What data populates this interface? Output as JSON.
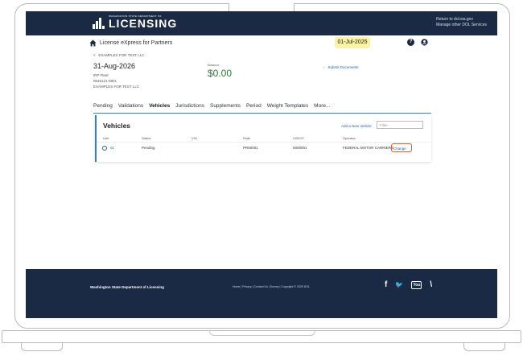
{
  "header": {
    "logo_small": "WASHINGTON STATE DEPARTMENT OF",
    "logo_big": "LICENSING",
    "return_link": "Return to dol.wa.gov",
    "manage_link": "Manage other DOL Services"
  },
  "app": {
    "title": "License eXpress for Partners",
    "date": "01-Jul-2025",
    "help_glyph": "?"
  },
  "breadcrumb": {
    "chevron": "<",
    "label": "EXAMPLES FOR TEST LLC"
  },
  "account": {
    "date": "31-Aug-2026",
    "type": "IRP Fleet",
    "id": "0546121-0801",
    "name": "EXAMPLES FOR TEST LLC",
    "balance_label": "Balance",
    "balance_value": "$0.00",
    "submit_documents": "Submit Documents"
  },
  "tabs": [
    {
      "label": "Pending"
    },
    {
      "label": "Validations"
    },
    {
      "label": "Vehicles"
    },
    {
      "label": "Jurisdictions"
    },
    {
      "label": "Supplements"
    },
    {
      "label": "Period"
    },
    {
      "label": "Weight Templates"
    },
    {
      "label": "More..."
    }
  ],
  "vehicles": {
    "title": "Vehicles",
    "add_link": "Add a New Vehicle",
    "filter_placeholder": "Filter",
    "columns": [
      "Unit",
      "Status",
      "VIN",
      "Plate",
      "USDOT",
      "Operator"
    ],
    "rows": [
      {
        "unit": "01",
        "status": "Pending",
        "vin": "",
        "plate": "PR50001",
        "usdot": "0000001",
        "operator": "FEDERAL MOTOR CARRIERS",
        "action": "Change"
      }
    ]
  },
  "footer": {
    "department": "Washington State Department of Licensing",
    "links": "Home | Privacy | Contact Us | Survey | Copyright © 2025 DOL",
    "social": [
      "f",
      "🐦",
      "You",
      "\\"
    ]
  },
  "colors": {
    "navy": "#1b2a44",
    "accent_blue": "#2f80c6",
    "date_badge": "#fbf2a4",
    "balance_green": "#2e7d3a",
    "highlight_orange": "#e05a2b"
  }
}
